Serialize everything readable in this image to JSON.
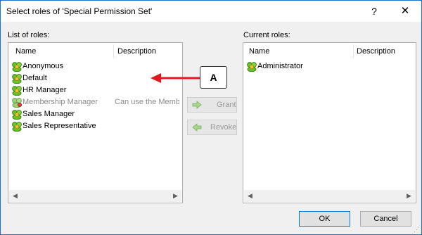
{
  "window": {
    "title": "Select roles of 'Special Permission Set'",
    "help_glyph": "?",
    "close_glyph": "✕"
  },
  "left": {
    "label": "List of roles:",
    "columns": [
      "Name",
      "Description"
    ],
    "rows": [
      {
        "name": "Anonymous",
        "description": "",
        "disabled": false
      },
      {
        "name": "Default",
        "description": "",
        "disabled": false
      },
      {
        "name": "HR Manager",
        "description": "",
        "disabled": false
      },
      {
        "name": "Membership Manager",
        "description": "Can use the Membe",
        "disabled": true
      },
      {
        "name": "Sales Manager",
        "description": "",
        "disabled": false
      },
      {
        "name": "Sales Representative",
        "description": "",
        "disabled": false
      }
    ]
  },
  "right": {
    "label": "Current roles:",
    "columns": [
      "Name",
      "Description"
    ],
    "rows": [
      {
        "name": "Administrator",
        "description": ""
      }
    ]
  },
  "actions": {
    "grant_label": "Grant",
    "revoke_label": "Revoke"
  },
  "footer": {
    "ok_label": "OK",
    "cancel_label": "Cancel"
  },
  "annotation": {
    "callout_label": "A",
    "arrow_color": "#e0191e"
  },
  "icons": {
    "role": "role-users-icon",
    "grant": "green-right-arrow-icon",
    "revoke": "green-left-arrow-icon"
  },
  "colors": {
    "accent": "#0078d7",
    "icon_green": "#6abf2a"
  }
}
